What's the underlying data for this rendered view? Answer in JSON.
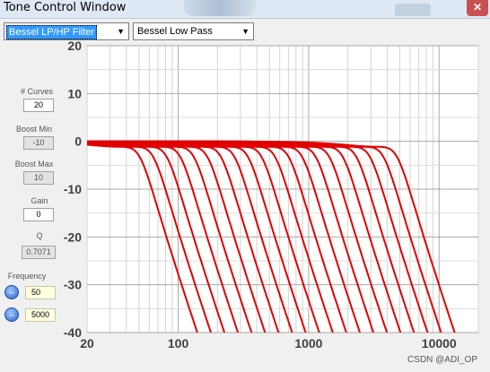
{
  "window": {
    "title": "Tone Control Window",
    "close_icon": "✕"
  },
  "filter_type": {
    "selected": "Bessel LP/HP Filter"
  },
  "filter_mode": {
    "selected": "Bessel Low Pass"
  },
  "controls": {
    "curves": {
      "label": "# Curves",
      "value": "20"
    },
    "boost_min": {
      "label": "Boost Min",
      "value": "-10"
    },
    "boost_max": {
      "label": "Boost Max",
      "value": "10"
    },
    "gain": {
      "label": "Gain",
      "value": "0"
    },
    "q": {
      "label": "Q",
      "value": "0.7071"
    },
    "frequency": {
      "label": "Frequency",
      "start": "50",
      "end": "5000"
    }
  },
  "watermark": "CSDN @ADI_OP",
  "chart_data": {
    "type": "line",
    "title": "",
    "xlabel": "",
    "ylabel": "",
    "x_scale": "log",
    "xlim": [
      20,
      20000
    ],
    "ylim": [
      -40,
      20
    ],
    "x_ticks": [
      "20",
      "100",
      "1000",
      "10000"
    ],
    "y_ticks": [
      "20",
      "10",
      "0",
      "-10",
      "-20",
      "-30",
      "-40"
    ],
    "grid": true,
    "line_color": "#e00000",
    "cutoff_frequencies": [
      50,
      63.5,
      80.6,
      102.4,
      130.1,
      165.2,
      209.8,
      266.5,
      338.5,
      429.9,
      546.1,
      693.6,
      881.0,
      1118.9,
      1421.2,
      1805.1,
      2292.8,
      2912.3,
      3699.0,
      4698.3
    ],
    "filter_order": 4
  }
}
